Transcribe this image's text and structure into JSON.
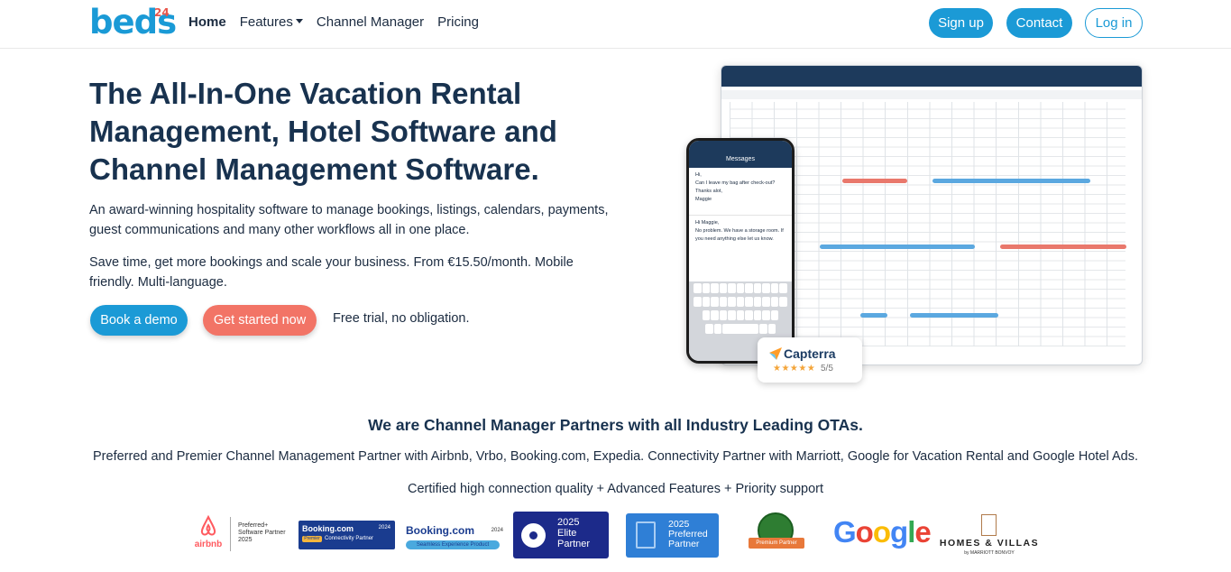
{
  "nav": {
    "logo_text": "beds",
    "logo_number": "24",
    "links": [
      {
        "label": "Home"
      },
      {
        "label": "Features"
      },
      {
        "label": "Channel Manager"
      },
      {
        "label": "Pricing"
      }
    ],
    "signup": "Sign up",
    "contact": "Contact",
    "login": "Log in"
  },
  "hero": {
    "title": "The All-In-One Vacation Rental Management, Hotel Software and Channel Management Software.",
    "description": "An award-winning hospitality software to manage bookings, listings, calendars, payments, guest communications and many other workflows all in one place.",
    "description2": "Save time, get more bookings and scale your business. From €15.50/month. Mobile friendly. Multi-language.",
    "demo_button": "Book a demo",
    "start_button": "Get started now",
    "free_trial": "Free trial, no obligation."
  },
  "mockup": {
    "phone_header": "Messages",
    "message1": "Hi,",
    "message2": "Can I leave my bag after check-out? Thanks alot,",
    "message3": "Maggie",
    "reply1": "Hi Maggie,",
    "reply2": "No problem. We have a storage room. If you need anything else let us know.",
    "capterra_name": "Capterra",
    "capterra_stars": "★★★★★",
    "capterra_rating": "5/5"
  },
  "partners": {
    "title": "We are Channel Manager Partners with all Industry Leading OTAs.",
    "description": "Preferred and Premier Channel Management Partner with Airbnb, Vrbo, Booking.com, Expedia. Connectivity Partner with Marriott, Google for Vacation Rental and Google Hotel Ads.",
    "quality": "Certified high connection quality + Advanced Features + Priority support",
    "badges": {
      "airbnb_name": "airbnb",
      "airbnb_line1": "Preferred+",
      "airbnb_line2": "Software Partner",
      "airbnb_year": "2025",
      "booking1_name": "Booking.com",
      "booking1_year": "2024",
      "booking1_tier": "Premier",
      "booking1_label": "Connectivity Partner",
      "booking2_name": "Booking.com",
      "booking2_year": "2024",
      "booking2_label": "Seamless Experience Product",
      "expedia_year": "2025",
      "expedia_l1": "Elite",
      "expedia_l2": "Partner",
      "vrbo_year": "2025",
      "vrbo_l1": "Preferred",
      "vrbo_l2": "Partner",
      "trip_label": "Premium Partner",
      "google": "Google",
      "hv_title": "HOMES & VILLAS",
      "hv_sub": "by MARRIOTT BONVOY"
    }
  }
}
